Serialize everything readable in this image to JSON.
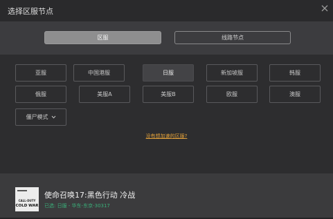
{
  "window": {
    "title": "选择区服节点",
    "close_icon": "close-icon"
  },
  "tabs": [
    {
      "label": "区服",
      "active": true
    },
    {
      "label": "线路节点",
      "active": false
    }
  ],
  "regions": [
    {
      "label": "亚服",
      "selected": false
    },
    {
      "label": "中国港服",
      "selected": false
    },
    {
      "label": "日服",
      "selected": true
    },
    {
      "label": "新加坡服",
      "selected": false
    },
    {
      "label": "韩服",
      "selected": false
    },
    {
      "label": "俄服",
      "selected": false
    },
    {
      "label": "美服A",
      "selected": false
    },
    {
      "label": "美服B",
      "selected": false
    },
    {
      "label": "欧服",
      "selected": false
    },
    {
      "label": "澳服",
      "selected": false
    }
  ],
  "mode_dropdown": {
    "label": "僵尸模式",
    "icon": "chevron-down-icon"
  },
  "missing_region_link": "没有想加速的区服?",
  "game": {
    "name": "使命召唤17:黑色行动 冷战",
    "status": "已选: 日服 - 华东-东京-30317",
    "cover_text": "CALL OF DUTY COLD WAR",
    "status_color": "#3ab07a"
  },
  "colors": {
    "accent_link": "#e3a13a",
    "active_tab": "#8e8e8f"
  }
}
